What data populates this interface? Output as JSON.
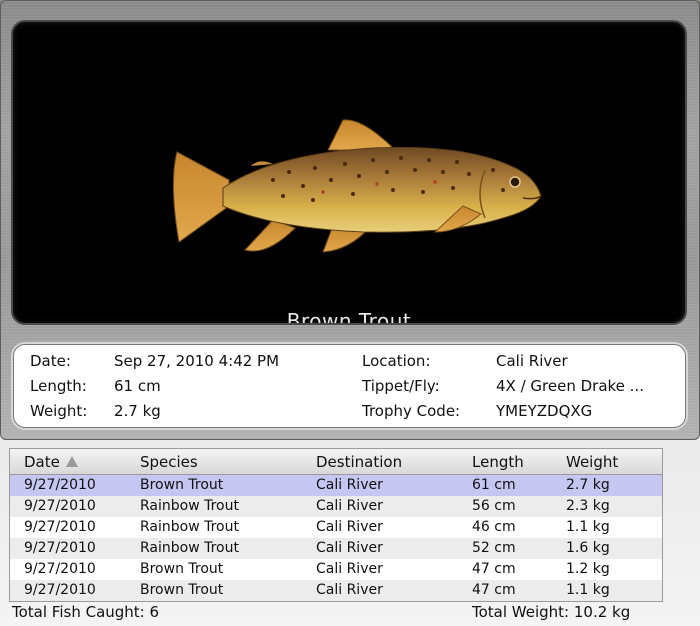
{
  "viewer": {
    "fish_name": "Brown Trout"
  },
  "info": {
    "date_label": "Date:",
    "date_value": "Sep 27, 2010  4:42 PM",
    "length_label": "Length:",
    "length_value": "61 cm",
    "weight_label": "Weight:",
    "weight_value": "2.7 kg",
    "location_label": "Location:",
    "location_value": "Cali River",
    "tippet_label": "Tippet/Fly:",
    "tippet_value": "4X / Green Drake ...",
    "trophy_label": "Trophy Code:",
    "trophy_value": "YMEYZDQXG"
  },
  "table": {
    "columns": [
      "Date",
      "Species",
      "Destination",
      "Length",
      "Weight"
    ],
    "sorted_column": "Date",
    "rows": [
      {
        "date": "9/27/2010",
        "species": "Brown Trout",
        "destination": "Cali River",
        "length": "61 cm",
        "weight": "2.7 kg",
        "selected": true
      },
      {
        "date": "9/27/2010",
        "species": "Rainbow Trout",
        "destination": "Cali River",
        "length": "56 cm",
        "weight": "2.3 kg"
      },
      {
        "date": "9/27/2010",
        "species": "Rainbow Trout",
        "destination": "Cali River",
        "length": "46 cm",
        "weight": "1.1 kg"
      },
      {
        "date": "9/27/2010",
        "species": "Rainbow Trout",
        "destination": "Cali River",
        "length": "52 cm",
        "weight": "1.6 kg"
      },
      {
        "date": "9/27/2010",
        "species": "Brown Trout",
        "destination": "Cali River",
        "length": "47 cm",
        "weight": "1.2 kg"
      },
      {
        "date": "9/27/2010",
        "species": "Brown Trout",
        "destination": "Cali River",
        "length": "47 cm",
        "weight": "1.1 kg"
      }
    ]
  },
  "footer": {
    "total_fish": "Total Fish Caught: 6",
    "total_weight": "Total Weight: 10.2 kg"
  },
  "colors": {
    "selected_row": "#c6c6f2",
    "viewer_background": "#000000"
  }
}
